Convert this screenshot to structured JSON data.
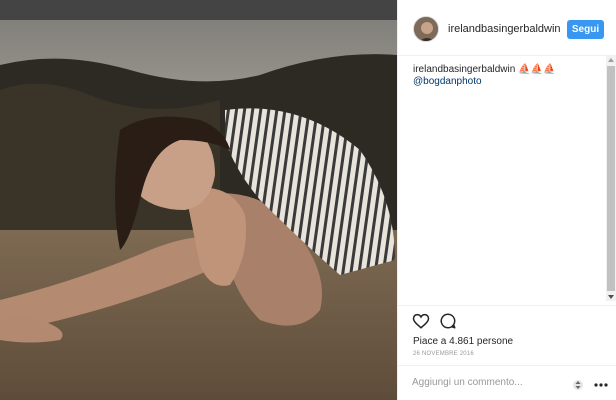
{
  "post": {
    "username": "irelandbasingerbaldwin",
    "follow_label": "Segui",
    "caption_text": "⛵⛵⛵",
    "mention": "@bogdanphoto",
    "likes": "Piace a 4.861 persone",
    "date": "26 NOVEMBRE 2016",
    "comment_placeholder": "Aggiungi un commento..."
  },
  "icons": {
    "like": "heart-icon",
    "comment": "comment-icon",
    "options": "more-options-icon"
  },
  "colors": {
    "follow_button": "#3897f0",
    "mention": "#003569",
    "text": "#262626"
  }
}
